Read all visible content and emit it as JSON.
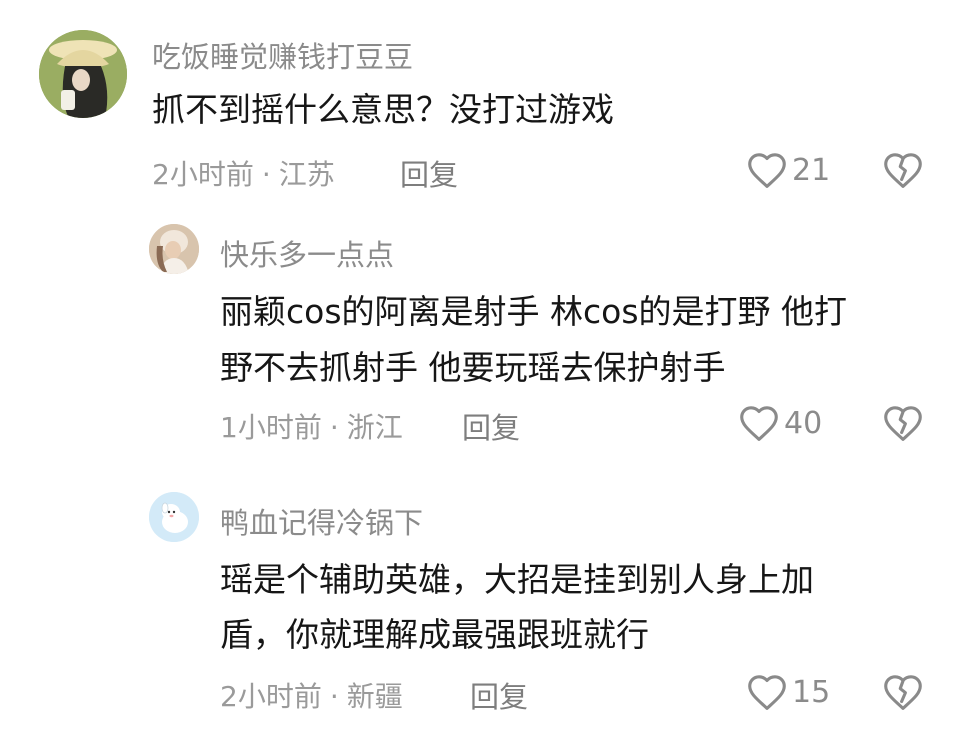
{
  "comments": [
    {
      "username": "吃饭睡觉赚钱打豆豆",
      "text": "抓不到摇什么意思？没打过游戏",
      "time": "2小时前",
      "location": "江苏",
      "reply_label": "回复",
      "likes": "21"
    },
    {
      "username": "快乐多一点点",
      "text": "丽颖cos的阿离是射手 林cos的是打野 他打\n野不去抓射手 他要玩瑶去保护射手",
      "time": "1小时前",
      "location": "浙江",
      "reply_label": "回复",
      "likes": "40"
    },
    {
      "username": "鸭血记得冷锅下",
      "text": "瑶是个辅助英雄，大招是挂到别人身上加\n盾，你就理解成最强跟班就行",
      "time": "2小时前",
      "location": "新疆",
      "reply_label": "回复",
      "likes": "15"
    }
  ],
  "colors": {
    "text_primary": "#161616",
    "text_secondary": "#8b8b8b",
    "text_meta": "#9a9a9a",
    "icon": "#8a8a8a"
  },
  "icons": {
    "like": "heart-outline-icon",
    "dislike": "broken-heart-icon"
  }
}
